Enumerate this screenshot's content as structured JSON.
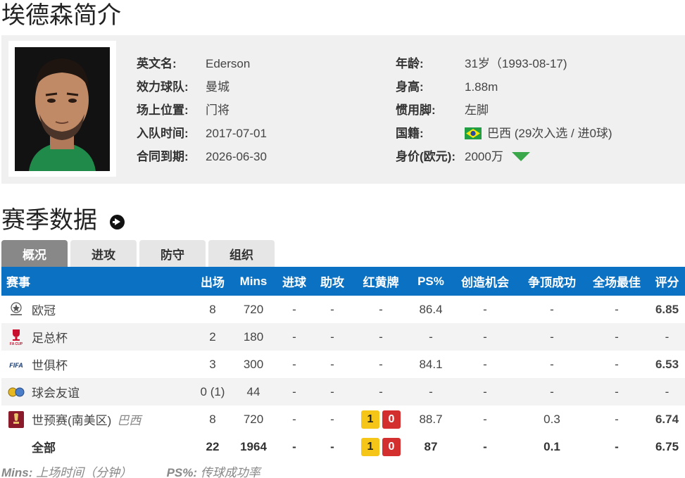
{
  "page_title": "埃德森简介",
  "profile": {
    "left": [
      {
        "label": "英文名:",
        "value": "Ederson"
      },
      {
        "label": "效力球队:",
        "value": "曼城"
      },
      {
        "label": "场上位置:",
        "value": "门将"
      },
      {
        "label": "入队时间:",
        "value": "2017-07-01"
      },
      {
        "label": "合同到期:",
        "value": "2026-06-30"
      }
    ],
    "right": [
      {
        "label": "年龄:",
        "value": "31岁（1993-08-17)"
      },
      {
        "label": "身高:",
        "value": "1.88m"
      },
      {
        "label": "惯用脚:",
        "value": "左脚"
      },
      {
        "label": "国籍:",
        "value": "巴西 (29次入选 / 进0球)"
      },
      {
        "label": "身价(欧元):",
        "value": "2000万"
      }
    ]
  },
  "section_title": "赛季数据",
  "tabs": [
    "概况",
    "进攻",
    "防守",
    "组织"
  ],
  "table": {
    "headers": [
      "赛事",
      "出场",
      "Mins",
      "进球",
      "助攻",
      "红黄牌",
      "PS%",
      "创造机会",
      "争顶成功",
      "全场最佳",
      "评分"
    ],
    "rows": [
      {
        "comp": "欧冠",
        "team": "",
        "apps": "8",
        "mins": "720",
        "goals": "-",
        "assists": "-",
        "cards": "-",
        "ps": "86.4",
        "chances": "-",
        "aerials": "-",
        "motm": "-",
        "rating": "6.85"
      },
      {
        "comp": "足总杯",
        "team": "",
        "apps": "2",
        "mins": "180",
        "goals": "-",
        "assists": "-",
        "cards": "-",
        "ps": "-",
        "chances": "-",
        "aerials": "-",
        "motm": "-",
        "rating": "-"
      },
      {
        "comp": "世俱杯",
        "team": "",
        "apps": "3",
        "mins": "300",
        "goals": "-",
        "assists": "-",
        "cards": "-",
        "ps": "84.1",
        "chances": "-",
        "aerials": "-",
        "motm": "-",
        "rating": "6.53"
      },
      {
        "comp": "球会友谊",
        "team": "",
        "apps": "0 (1)",
        "mins": "44",
        "goals": "-",
        "assists": "-",
        "cards": "-",
        "ps": "-",
        "chances": "-",
        "aerials": "-",
        "motm": "-",
        "rating": "-"
      },
      {
        "comp": "世预赛(南美区)",
        "team": "巴西",
        "apps": "8",
        "mins": "720",
        "goals": "-",
        "assists": "-",
        "yellow": "1",
        "red": "0",
        "ps": "88.7",
        "chances": "-",
        "aerials": "0.3",
        "motm": "-",
        "rating": "6.74"
      }
    ],
    "total": {
      "comp": "全部",
      "apps": "22",
      "mins": "1964",
      "goals": "-",
      "assists": "-",
      "yellow": "1",
      "red": "0",
      "ps": "87",
      "chances": "-",
      "aerials": "0.1",
      "motm": "-",
      "rating": "6.75"
    }
  },
  "footnote": {
    "mins_key": "Mins:",
    "mins_desc": "上场时间（分钟）",
    "ps_key": "PS%:",
    "ps_desc": "传球成功率"
  },
  "icons": [
    "ucl-logo-icon",
    "fa-cup-logo-icon",
    "fifa-logo-icon",
    "friendly-logo-icon",
    "wc-qualifier-logo-icon",
    "brazil-flag-icon",
    "value-down-arrow-icon",
    "circle-arrow-icon"
  ],
  "colors": {
    "header_blue": "#0b72c3",
    "rating_orange": "#e06a16",
    "active_tab": "#888888",
    "value_down": "#3aa84a"
  }
}
